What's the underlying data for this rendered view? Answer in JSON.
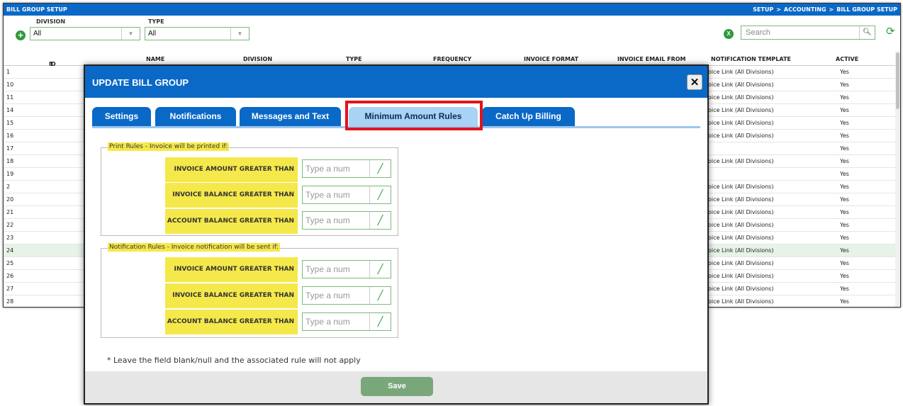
{
  "app": {
    "title": "BILL GROUP SETUP",
    "breadcrumb": [
      "SETUP",
      "ACCOUNTING",
      "BILL GROUP SETUP"
    ],
    "breadcrumb_sep": ">",
    "filters": {
      "division_label": "DIVISION",
      "division_value": "All",
      "type_label": "TYPE",
      "type_value": "All"
    },
    "search_placeholder": "Search",
    "grid": {
      "columns": [
        "ID",
        "NAME",
        "DIVISION",
        "TYPE",
        "FREQUENCY",
        "INVOICE FORMAT",
        "INVOICE EMAIL FROM",
        "NOTIFICATION TEMPLATE",
        "ACTIVE"
      ],
      "sort_indicator": "↑",
      "rows": [
        {
          "id": "1",
          "template": "oice Link (All Divisions)",
          "active": "Yes"
        },
        {
          "id": "10",
          "template": "oice Link (All Divisions)",
          "active": "Yes"
        },
        {
          "id": "11",
          "template": "oice Link (All Divisions)",
          "active": "Yes"
        },
        {
          "id": "14",
          "template": "oice Link (All Divisions)",
          "active": "Yes"
        },
        {
          "id": "15",
          "template": "oice Link (All Divisions)",
          "active": "Yes"
        },
        {
          "id": "16",
          "template": "oice Link (All Divisions)",
          "active": "Yes"
        },
        {
          "id": "17",
          "template": "",
          "active": "Yes"
        },
        {
          "id": "18",
          "template": "oice Link (All Divisions)",
          "active": "Yes"
        },
        {
          "id": "19",
          "template": "",
          "active": "Yes"
        },
        {
          "id": "2",
          "template": "oice Link (All Divisions)",
          "active": "Yes"
        },
        {
          "id": "20",
          "template": "oice Link (All Divisions)",
          "active": "Yes"
        },
        {
          "id": "21",
          "template": "oice Link (All Divisions)",
          "active": "Yes"
        },
        {
          "id": "22",
          "template": "oice Link (All Divisions)",
          "active": "Yes"
        },
        {
          "id": "23",
          "template": "oice Link (All Divisions)",
          "active": "Yes"
        },
        {
          "id": "24",
          "template": "oice Link (All Divisions)",
          "active": "Yes",
          "selected": true
        },
        {
          "id": "25",
          "template": "oice Link (All Divisions)",
          "active": "Yes"
        },
        {
          "id": "26",
          "template": "oice Link (All Divisions)",
          "active": "Yes"
        },
        {
          "id": "27",
          "template": "oice Link (All Divisions)",
          "active": "Yes"
        },
        {
          "id": "28",
          "template": "oice Link (All Divisions)",
          "active": "Yes"
        }
      ]
    }
  },
  "modal": {
    "title": "UPDATE BILL GROUP",
    "close": "✕",
    "tabs": [
      "Settings",
      "Notifications",
      "Messages and Text",
      "Minimum Amount Rules",
      "Catch Up Billing"
    ],
    "active_tab": "Minimum Amount Rules",
    "print_rules": {
      "legend": "Print Rules - Invoice will be printed if:",
      "rules": [
        {
          "label": "INVOICE AMOUNT GREATER THAN",
          "placeholder": "Type a num"
        },
        {
          "label": "INVOICE BALANCE GREATER THAN",
          "placeholder": "Type a num"
        },
        {
          "label": "ACCOUNT BALANCE GREATER THAN",
          "placeholder": "Type a num"
        }
      ]
    },
    "notification_rules": {
      "legend": "Notification Rules - Invoice notification will be sent if:",
      "rules": [
        {
          "label": "INVOICE AMOUNT GREATER THAN",
          "placeholder": "Type a num"
        },
        {
          "label": "INVOICE BALANCE GREATER THAN",
          "placeholder": "Type a num"
        },
        {
          "label": "ACCOUNT BALANCE GREATER THAN",
          "placeholder": "Type a num"
        }
      ]
    },
    "note": "* Leave the field blank/null and the associated rule will not apply",
    "save_label": "Save"
  },
  "colors": {
    "header_blue": "#0a69c7",
    "highlight_yellow": "#f5e84a",
    "highlight_red": "#e0141b",
    "accent_green": "#2e9b3a"
  }
}
